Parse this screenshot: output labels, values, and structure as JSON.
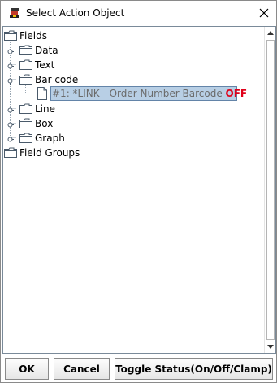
{
  "window": {
    "title": "Select Action Object"
  },
  "tree": {
    "root_fields": "Fields",
    "data": "Data",
    "text": "Text",
    "barcode": "Bar code",
    "barcode_item_prefix": "#1: *LINK - Order Number Barcode ",
    "barcode_item_status": "OFF",
    "line": "Line",
    "box": "Box",
    "graph": "Graph",
    "root_field_groups": "Field Groups"
  },
  "buttons": {
    "ok": "OK",
    "cancel": "Cancel",
    "toggle": "Toggle Status(On/Off/Clamp)"
  },
  "colors": {
    "status_off": "#e0001a",
    "selection_bg": "#b8cfe5"
  },
  "icons": [
    "app-icon",
    "close-icon",
    "folder-icon",
    "document-icon",
    "expand-handle-icon",
    "scroll-up-icon",
    "scroll-down-icon"
  ]
}
